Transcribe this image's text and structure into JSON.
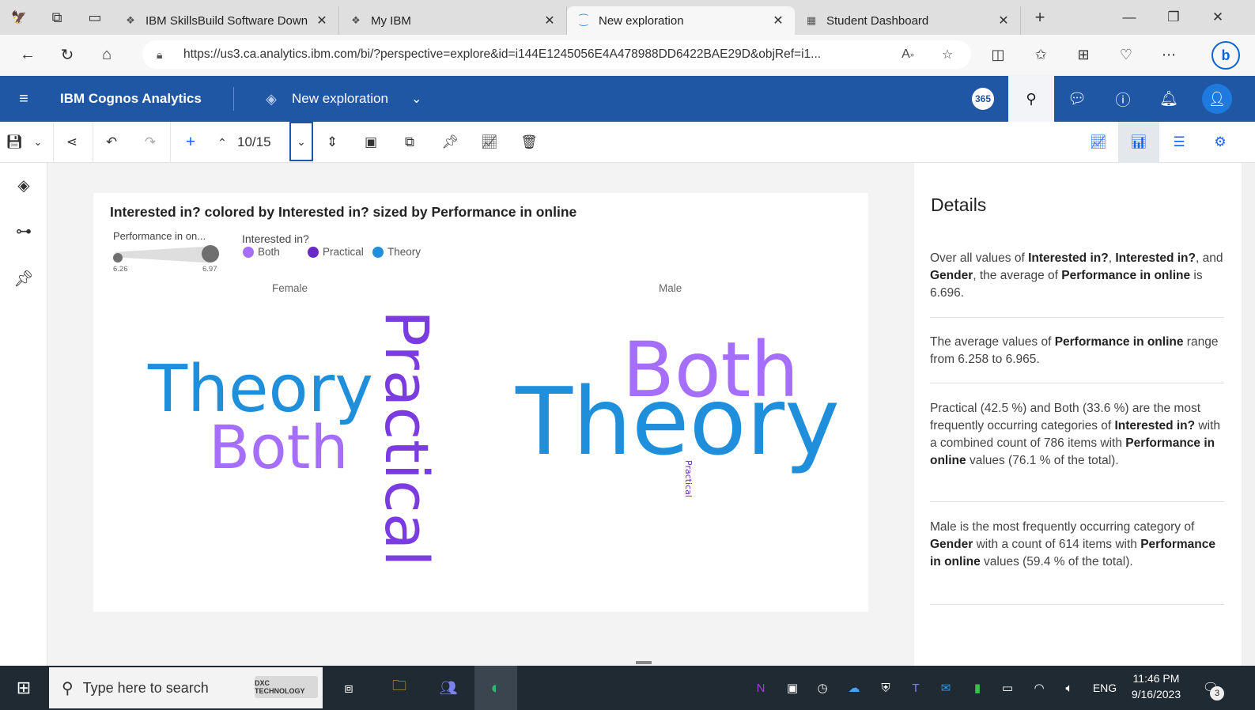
{
  "browser": {
    "tabs": [
      {
        "label": "IBM SkillsBuild Software Downlo",
        "active": false
      },
      {
        "label": "My IBM",
        "active": false
      },
      {
        "label": "New exploration",
        "active": true
      },
      {
        "label": "Student Dashboard",
        "active": false
      }
    ],
    "url": "https://us3.ca.analytics.ibm.com/bi/?perspective=explore&id=i144E1245056E4A478988DD6422BAE29D&objRef=i1..."
  },
  "app": {
    "brand": "IBM Cognos Analytics",
    "exploration_title": "New exploration",
    "badge": "365"
  },
  "toolbar": {
    "page_indicator": "10/15"
  },
  "chart": {
    "title": "Interested in? colored by Interested in? sized by Performance in online",
    "size_legend_label": "Performance in on...",
    "size_min": "6.26",
    "size_max": "6.97",
    "color_legend_label": "Interested in?",
    "legend": [
      {
        "label": "Both",
        "color": "#a56eff"
      },
      {
        "label": "Practical",
        "color": "#6929c4"
      },
      {
        "label": "Theory",
        "color": "#1f8fdb"
      }
    ],
    "facets": [
      "Female",
      "Male"
    ],
    "words": {
      "female_theory": "Theory",
      "female_both": "Both",
      "female_practical": "Practical",
      "male_both": "Both",
      "male_theory": "Theory",
      "male_practical": "Practical"
    }
  },
  "chart_data": {
    "type": "table",
    "title": "Interested in? colored by Interested in? sized by Performance in online",
    "size_range": [
      6.26,
      6.97
    ],
    "facets": [
      "Female",
      "Male"
    ],
    "categories": [
      "Both",
      "Practical",
      "Theory"
    ]
  },
  "details": {
    "title": "Details",
    "insights": [
      {
        "parts": [
          [
            "Over all values of ",
            false
          ],
          [
            "Interested in?",
            true
          ],
          [
            ", ",
            false
          ],
          [
            "Interested in?",
            true
          ],
          [
            ", and ",
            false
          ],
          [
            "Gender",
            true
          ],
          [
            ", the average of ",
            false
          ],
          [
            "Performance in online",
            true
          ],
          [
            " is 6.696.",
            false
          ]
        ]
      },
      {
        "parts": [
          [
            "The average values of ",
            false
          ],
          [
            "Performance in online",
            true
          ],
          [
            " range from 6.258 to 6.965.",
            false
          ]
        ]
      },
      {
        "parts": [
          [
            "Practical (42.5 %) and Both (33.6 %) are the most frequently occurring categories of ",
            false
          ],
          [
            "Interested in?",
            true
          ],
          [
            " with a combined count of 786 items with ",
            false
          ],
          [
            "Performance in online",
            true
          ],
          [
            " values (76.1 % of the total).",
            false
          ]
        ]
      },
      {
        "parts": [
          [
            "Male is the most frequently occurring category of ",
            false
          ],
          [
            "Gender",
            true
          ],
          [
            " with a count of 614 items with ",
            false
          ],
          [
            "Performance in online",
            true
          ],
          [
            " values (59.4 % of the total).",
            false
          ]
        ]
      }
    ]
  },
  "taskbar": {
    "search_placeholder": "Type here to search",
    "dxc_label": "DXC TECHNOLOGY",
    "language": "ENG",
    "time": "11:46 PM",
    "date": "9/16/2023",
    "notification_count": "3"
  }
}
